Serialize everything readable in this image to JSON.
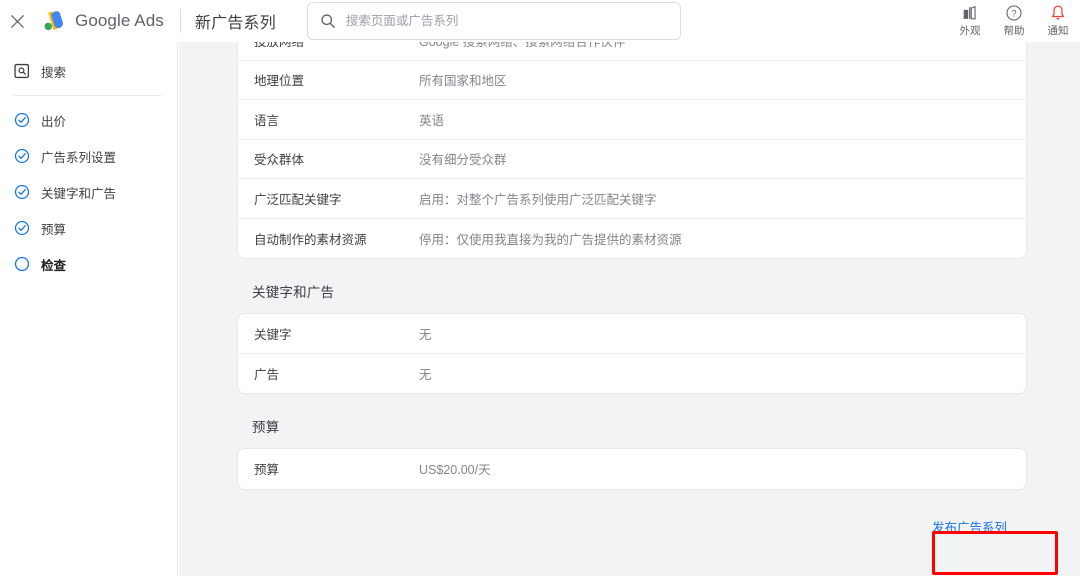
{
  "header": {
    "close_icon": "close-icon",
    "brand": "Google Ads",
    "brand_google": "Google",
    "brand_ads": "Ads",
    "page_title": "新广告系列",
    "search": {
      "icon": "search-icon",
      "placeholder": "搜索页面或广告系列",
      "value": ""
    },
    "actions": [
      {
        "icon": "appearance-icon",
        "label": "外观"
      },
      {
        "icon": "help-icon",
        "label": "帮助"
      },
      {
        "icon": "notifications-bell-icon",
        "label": "通知"
      }
    ]
  },
  "sidebar": {
    "items": [
      {
        "label": "搜索",
        "icon": "search-square-icon",
        "state": "header"
      },
      {
        "label": "出价",
        "icon": "check-circle-icon",
        "state": "done"
      },
      {
        "label": "广告系列设置",
        "icon": "check-circle-icon",
        "state": "done"
      },
      {
        "label": "关键字和广告",
        "icon": "check-circle-icon",
        "state": "done"
      },
      {
        "label": "预算",
        "icon": "check-circle-icon",
        "state": "done"
      },
      {
        "label": "检查",
        "icon": "empty-circle-icon",
        "state": "current"
      }
    ]
  },
  "main": {
    "settings_card": {
      "rows": [
        {
          "key": "投放网络",
          "value": "Google 搜索网络、搜索网络合作伙伴"
        },
        {
          "key": "地理位置",
          "value": "所有国家和地区"
        },
        {
          "key": "语言",
          "value": "英语"
        },
        {
          "key": "受众群体",
          "value": "没有细分受众群"
        },
        {
          "key": "广泛匹配关键字",
          "value": "启用：对整个广告系列使用广泛匹配关键字"
        },
        {
          "key": "自动制作的素材资源",
          "value": "停用：仅使用我直接为我的广告提供的素材资源"
        }
      ]
    },
    "keywords_section": {
      "title": "关键字和广告",
      "rows": [
        {
          "key": "关键字",
          "value": "无"
        },
        {
          "key": "广告",
          "value": "无"
        }
      ]
    },
    "budget_section": {
      "title": "预算",
      "rows": [
        {
          "key": "预算",
          "value": "US$20.00/天"
        }
      ]
    },
    "publish_button": "发布广告系列"
  },
  "colors": {
    "accent_blue": "#1a73e8",
    "check_blue": "#1a73e8",
    "highlight_red": "#ff0000",
    "main_bg": "#f1f3f4",
    "card_bg": "#ffffff"
  }
}
